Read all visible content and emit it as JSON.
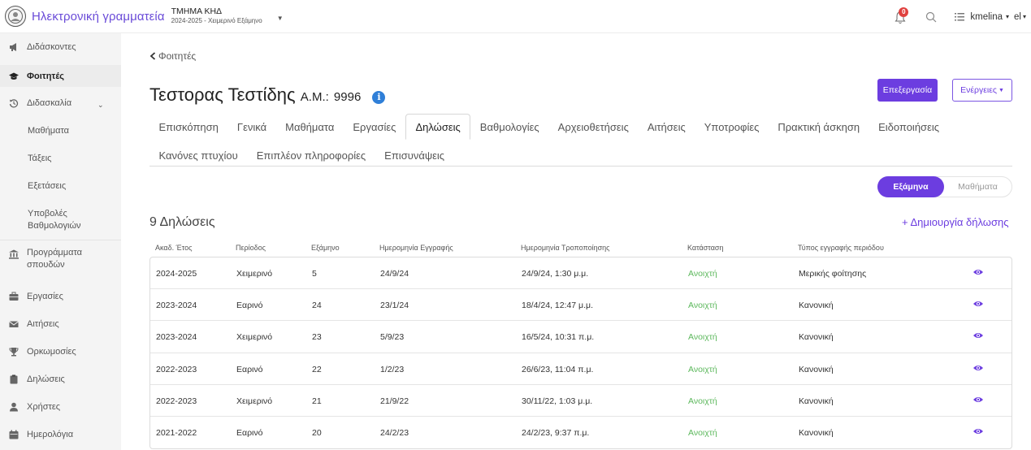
{
  "header": {
    "app_title": "Ηλεκτρονική γραμματεία",
    "department": "ΤΜΗΜΑ ΚΗΔ",
    "period": "2024-2025 - Χειμερινό Εξάμηνο",
    "notifications_count": "0",
    "username": "kmelina",
    "language": "el"
  },
  "sidebar": {
    "items": [
      {
        "label": "Διδάσκοντες",
        "icon": "megaphone-icon"
      },
      {
        "label": "Φοιτητές",
        "icon": "graduation-cap-icon"
      },
      {
        "label": "Διδασκαλία",
        "icon": "history-icon"
      },
      {
        "label": "Μαθήματα"
      },
      {
        "label": "Τάξεις"
      },
      {
        "label": "Εξετάσεις"
      },
      {
        "label": "Υποβολές Βαθμολογιών"
      },
      {
        "label": "Προγράμματα σπουδών",
        "icon": "institution-icon"
      },
      {
        "label": "Εργασίες",
        "icon": "briefcase-icon"
      },
      {
        "label": "Αιτήσεις",
        "icon": "envelope-icon"
      },
      {
        "label": "Ορκωμοσίες",
        "icon": "trophy-icon"
      },
      {
        "label": "Δηλώσεις",
        "icon": "clipboard-icon"
      },
      {
        "label": "Χρήστες",
        "icon": "user-icon"
      },
      {
        "label": "Ημερολόγια",
        "icon": "calendar-icon"
      }
    ]
  },
  "page": {
    "back_label": "Φοιτητές",
    "student_name": "Τεστορας Τεστίδης",
    "am_label": "Α.Μ.:",
    "am_value": "9996",
    "edit_button": "Επεξεργασία",
    "actions_button": "Ενέργειες",
    "tabs_row1": [
      "Επισκόπηση",
      "Γενικά",
      "Μαθήματα",
      "Εργασίες",
      "Δηλώσεις",
      "Βαθμολογίες",
      "Αρχειοθετήσεις",
      "Αιτήσεις",
      "Υποτροφίες",
      "Πρακτική άσκηση",
      "Ειδοποιήσεις"
    ],
    "tabs_row2": [
      "Κανόνες πτυχίου",
      "Επιπλέον πληροφορίες",
      "Επισυνάψεις"
    ],
    "active_tab": "Δηλώσεις",
    "toggle_on": "Εξάμηνα",
    "toggle_off": "Μαθήματα",
    "count_title": "9 Δηλώσεις",
    "create_link": "+ Δημιουργία δήλωσης"
  },
  "table": {
    "headers": [
      "Ακαδ. Έτος",
      "Περίοδος",
      "Εξάμηνο",
      "Ημερομηνία Εγγραφής",
      "Ημερομηνία Τροποποίησης",
      "Κατάσταση",
      "Τύπος εγγραφής περιόδου"
    ],
    "rows": [
      [
        "2024-2025",
        "Χειμερινό",
        "5",
        "24/9/24",
        "24/9/24, 1:30 μ.μ.",
        "Ανοιχτή",
        "Μερικής φοίτησης"
      ],
      [
        "2023-2024",
        "Εαρινό",
        "24",
        "23/1/24",
        "18/4/24, 12:47 μ.μ.",
        "Ανοιχτή",
        "Κανονική"
      ],
      [
        "2023-2024",
        "Χειμερινό",
        "23",
        "5/9/23",
        "16/5/24, 10:31 π.μ.",
        "Ανοιχτή",
        "Κανονική"
      ],
      [
        "2022-2023",
        "Εαρινό",
        "22",
        "1/2/23",
        "26/6/23, 11:04 π.μ.",
        "Ανοιχτή",
        "Κανονική"
      ],
      [
        "2022-2023",
        "Χειμερινό",
        "21",
        "21/9/22",
        "30/11/22, 1:03 μ.μ.",
        "Ανοιχτή",
        "Κανονική"
      ],
      [
        "2021-2022",
        "Εαρινό",
        "20",
        "24/2/23",
        "24/2/23, 9:37 π.μ.",
        "Ανοιχτή",
        "Κανονική"
      ]
    ]
  },
  "colors": {
    "accent": "#6c3de0",
    "status_open": "#5cb85c",
    "sidebar_bg": "#f4f4f4"
  }
}
